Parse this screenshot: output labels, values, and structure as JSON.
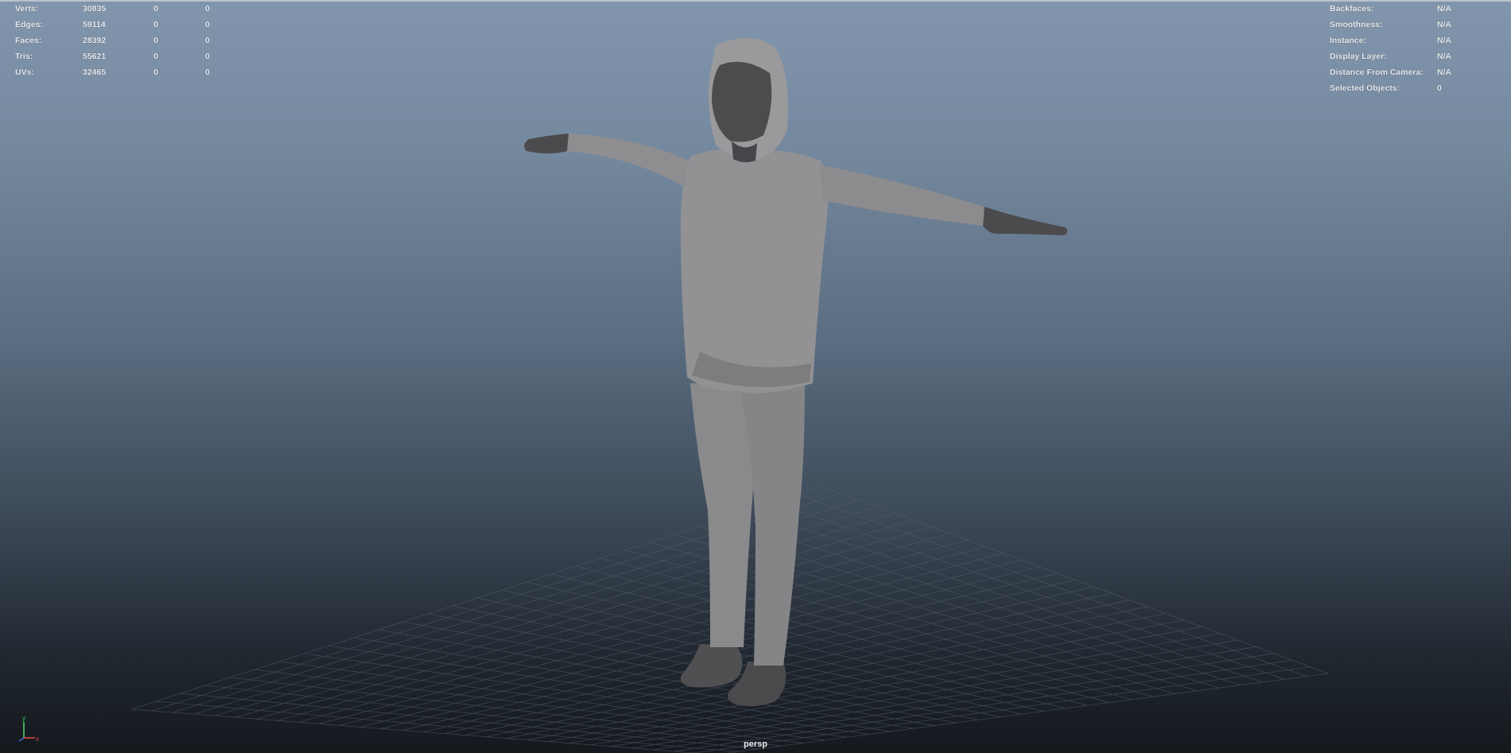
{
  "viewport": {
    "camera": "persp",
    "background_top": "#8196ad",
    "background_bottom": "#15191e"
  },
  "heads_up_left": [
    {
      "label": "Verts:",
      "v1": "30835",
      "v2": "0",
      "v3": "0"
    },
    {
      "label": "Edges:",
      "v1": "59114",
      "v2": "0",
      "v3": "0"
    },
    {
      "label": "Faces:",
      "v1": "28392",
      "v2": "0",
      "v3": "0"
    },
    {
      "label": "Tris:",
      "v1": "55621",
      "v2": "0",
      "v3": "0"
    },
    {
      "label": "UVs:",
      "v1": "32465",
      "v2": "0",
      "v3": "0"
    }
  ],
  "heads_up_right": [
    {
      "label": "Backfaces:",
      "value": "N/A"
    },
    {
      "label": "Smoothness:",
      "value": "N/A"
    },
    {
      "label": "Instance:",
      "value": "N/A"
    },
    {
      "label": "Display Layer:",
      "value": "N/A"
    },
    {
      "label": "Distance From Camera:",
      "value": "N/A"
    },
    {
      "label": "Selected Objects:",
      "value": "0"
    }
  ],
  "axis_gizmo": {
    "y": "y",
    "x": "x",
    "icon": "axis-gizmo-icon"
  },
  "model": {
    "icon": "character-mesh-icon",
    "color": "#9a9a9c"
  }
}
